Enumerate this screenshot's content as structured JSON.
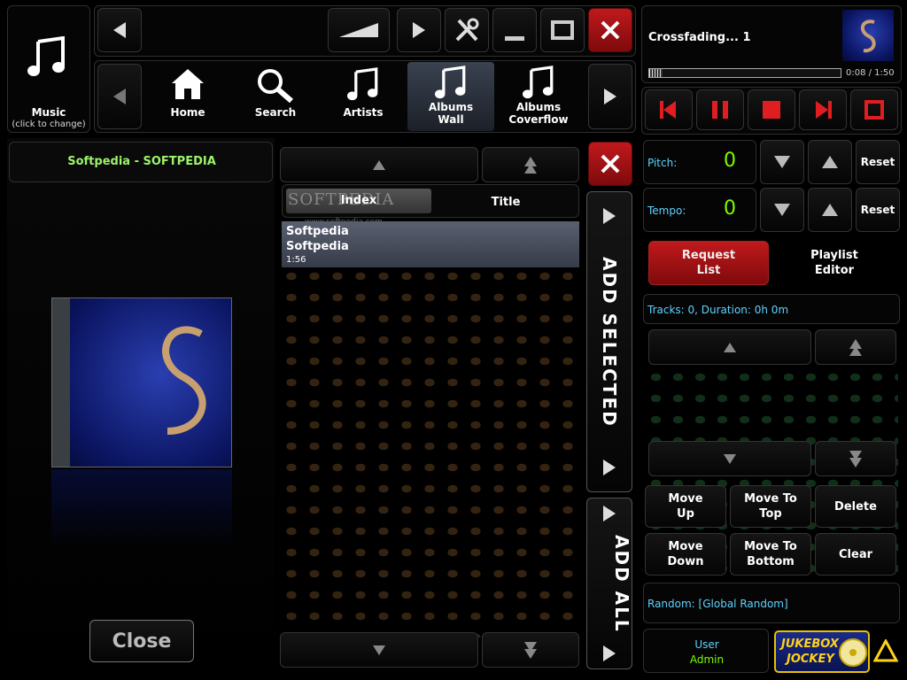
{
  "colors": {
    "accent_green": "#7cfc00",
    "cyan_text": "#5fd3ff",
    "red_btn": "#c0191c",
    "title_green": "#9cf56a"
  },
  "source": {
    "label": "Music",
    "sublabel": "(click to change)",
    "icon": "music-note-icon"
  },
  "nav": {
    "items": [
      {
        "label": "Home",
        "icon": "home-icon"
      },
      {
        "label": "Search",
        "icon": "search-icon"
      },
      {
        "label": "Artists",
        "icon": "music-note-icon"
      },
      {
        "label": "Albums\nWall",
        "icon": "music-note-icon"
      },
      {
        "label": "Albums\nCoverflow",
        "icon": "music-note-icon"
      }
    ],
    "active_index": 3
  },
  "nowplaying": {
    "status": "Crossfading... 1",
    "time": "0:08 / 1:50",
    "progress": 0.07
  },
  "album": {
    "title": "Softpedia - SOFTPEDIA",
    "close_label": "Close"
  },
  "tracklist": {
    "columns": [
      "Index",
      "Title"
    ],
    "watermark": "SOFTPEDIA",
    "watermark_url": "www.softpedia.com",
    "rows": [
      {
        "line1": "Softpedia",
        "line2": "Softpedia",
        "duration": "1:56"
      }
    ]
  },
  "actions": {
    "add_selected": "ADD SELECTED",
    "add_all": "ADD ALL"
  },
  "pitch": {
    "label": "Pitch:",
    "value": "0",
    "reset": "Reset"
  },
  "tempo": {
    "label": "Tempo:",
    "value": "0",
    "reset": "Reset"
  },
  "tabs": {
    "request_list": "Request\nList",
    "playlist_editor": "Playlist\nEditor"
  },
  "queue": {
    "summary": "Tracks: 0, Duration: 0h 0m"
  },
  "queue_buttons": {
    "move_up": "Move\nUp",
    "move_to_top": "Move To\nTop",
    "delete": "Delete",
    "move_down": "Move\nDown",
    "move_to_bottom": "Move To\nBottom",
    "clear": "Clear"
  },
  "random": {
    "text": "Random: [Global Random]"
  },
  "user": {
    "label": "User",
    "name": "Admin"
  },
  "logo": {
    "line1": "JUKEBOX",
    "line2": "JOCKEY"
  }
}
